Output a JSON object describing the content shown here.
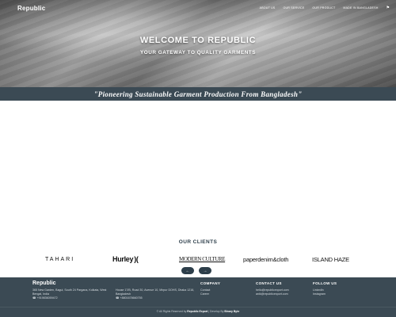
{
  "nav": {
    "logo": "Republic",
    "links": [
      "ABOUT US",
      "OUR SERVICE",
      "OUR PRODUCT",
      "MADE IN BANGLADESH"
    ],
    "lang_icon": "flag-icon"
  },
  "hero": {
    "title": "WELCOME TO REPUBLIC",
    "subtitle": "YOUR GATEWAY TO QUALITY GARMENTS"
  },
  "tagline": "\"Pioneering Sustainable Garment Production From Bangladesh\"",
  "clients": {
    "title": "OUR CLIENTS",
    "logos": [
      "TAHARI",
      "Hurley",
      "MODERN CULTURE",
      "paperdenim&cloth",
      "ISLAND HAZE"
    ],
    "prev_icon": "←",
    "next_icon": "→"
  },
  "footer": {
    "logo": "Republic",
    "address1": "365 New Garden, Bagui, South 24 Pargana, Kolkata, West Bengal, India",
    "phone1": "+919836059472",
    "address2": "House 17/B, Road 30, Avenue 10, Mirpur DOHS, Dhaka 1216, Bangladesh",
    "phone2": "+8801678660755",
    "company_heading": "COMPANY",
    "company_links": [
      "Contact",
      "Career"
    ],
    "contact_heading": "CONTACT US",
    "emails": [
      "hello@republicexport.com",
      "anik@republicexport.com"
    ],
    "follow_heading": "FOLLOW US",
    "social_links": [
      "LinkedIn",
      "Instagram"
    ],
    "copyright_prefix": "© All Rights Reserved by",
    "copyright_company": "Republic Export",
    "copyright_mid": "| Develop By",
    "copyright_dev": "Binary Byte"
  },
  "colors": {
    "dark_slate": "#3b4a54",
    "heading": "#2d3e4a"
  }
}
